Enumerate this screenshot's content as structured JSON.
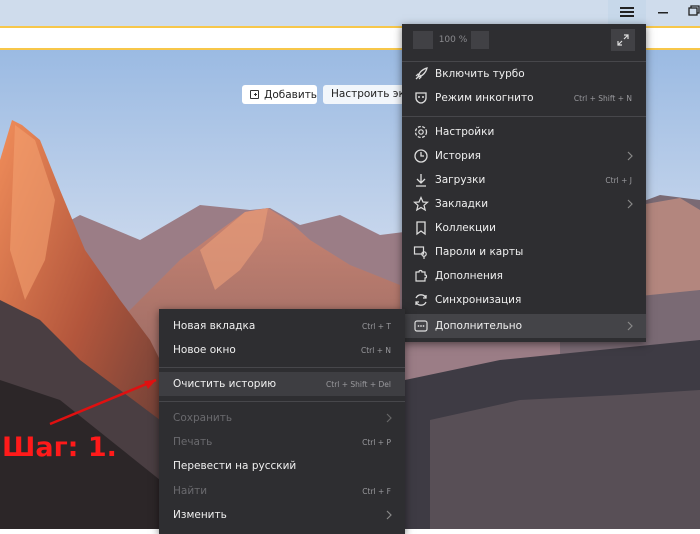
{
  "address_bar": {
    "value": ""
  },
  "new_tab": {
    "add_label": "Добавить",
    "customize_label": "Настроить экра"
  },
  "main_menu": {
    "zoom_value": "100 %",
    "items": [
      {
        "label": "Включить турбо",
        "shortcut": "",
        "icon": "rocket-icon"
      },
      {
        "label": "Режим инкогнито",
        "shortcut": "Ctrl + Shift + N",
        "icon": "incognito-mask-icon"
      },
      {
        "label": "Настройки",
        "shortcut": "",
        "icon": "gear-icon"
      },
      {
        "label": "История",
        "shortcut": "",
        "icon": "clock-icon",
        "submenu": true
      },
      {
        "label": "Загрузки",
        "shortcut": "Ctrl + J",
        "icon": "download-icon"
      },
      {
        "label": "Закладки",
        "shortcut": "",
        "icon": "star-icon",
        "submenu": true
      },
      {
        "label": "Коллекции",
        "shortcut": "",
        "icon": "bookmark-icon"
      },
      {
        "label": "Пароли и карты",
        "shortcut": "",
        "icon": "key-card-icon"
      },
      {
        "label": "Дополнения",
        "shortcut": "",
        "icon": "puzzle-icon"
      },
      {
        "label": "Синхронизация",
        "shortcut": "",
        "icon": "sync-icon"
      },
      {
        "label": "Дополнительно",
        "shortcut": "",
        "icon": "more-icon",
        "submenu": true,
        "highlighted": true
      }
    ]
  },
  "context_menu": {
    "items": [
      {
        "label": "Новая вкладка",
        "shortcut": "Ctrl + T"
      },
      {
        "label": "Новое окно",
        "shortcut": "Ctrl + N"
      },
      {
        "label": "Очистить историю",
        "shortcut": "Ctrl + Shift + Del",
        "highlighted": true
      },
      {
        "label": "Сохранить",
        "shortcut": "",
        "disabled": true,
        "submenu": true
      },
      {
        "label": "Печать",
        "shortcut": "Ctrl + P",
        "disabled": true
      },
      {
        "label": "Перевести на русский",
        "shortcut": ""
      },
      {
        "label": "Найти",
        "shortcut": "Ctrl + F",
        "disabled": true
      },
      {
        "label": "Изменить",
        "shortcut": "",
        "submenu": true
      }
    ]
  },
  "annotation": {
    "label": "Шаг: 1."
  },
  "colors": {
    "accent": "#f7c74a",
    "annotation": "#ff1a1a",
    "menu_bg": "#2e2e31"
  }
}
